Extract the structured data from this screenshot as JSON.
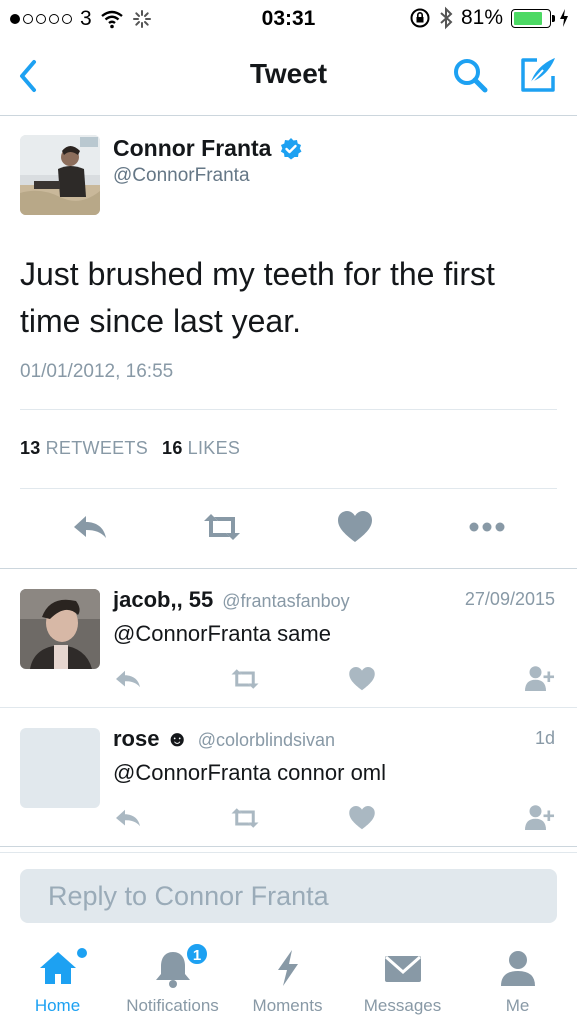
{
  "status_bar": {
    "carrier": "3",
    "time": "03:31",
    "battery_percent": "81%",
    "battery_level": 0.81,
    "signal_bars_filled": 1
  },
  "nav": {
    "title": "Tweet",
    "accent_color": "#1da1f2"
  },
  "tweet": {
    "author_name": "Connor Franta",
    "author_handle": "@ConnorFranta",
    "verified": true,
    "text": "Just brushed my teeth for the first time since last year.",
    "timestamp": "01/01/2012, 16:55",
    "retweets_count": "13",
    "retweets_label": "RETWEETS",
    "likes_count": "16",
    "likes_label": "LIKES"
  },
  "replies": [
    {
      "name": "jacob,, 55",
      "handle": "@frantasfanboy",
      "date": "27/09/2015",
      "text": "@ConnorFranta same"
    },
    {
      "name": "rose ☻",
      "handle": "@colorblindsivan",
      "date": "1d",
      "text": "@ConnorFranta connor oml"
    }
  ],
  "reply_box": {
    "placeholder": "Reply to Connor Franta"
  },
  "tabbar": {
    "tabs": [
      {
        "label": "Home",
        "icon": "home-icon",
        "active": true
      },
      {
        "label": "Notifications",
        "icon": "bell-icon",
        "badge": "1"
      },
      {
        "label": "Moments",
        "icon": "lightning-icon"
      },
      {
        "label": "Messages",
        "icon": "envelope-icon"
      },
      {
        "label": "Me",
        "icon": "person-icon"
      }
    ]
  }
}
